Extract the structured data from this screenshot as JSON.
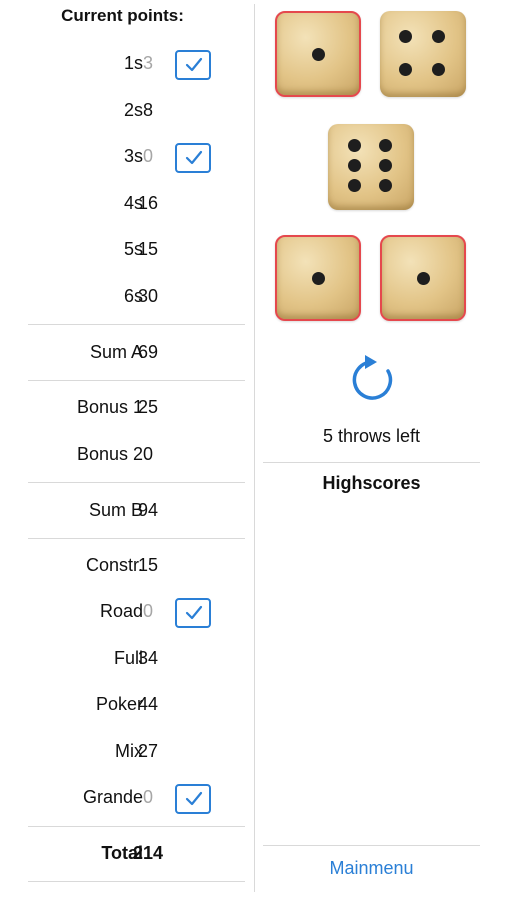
{
  "score": {
    "title": "Current points:",
    "upper": [
      {
        "label": "1s",
        "value": "3",
        "muted": true,
        "checked": true
      },
      {
        "label": "2s",
        "value": "8",
        "muted": false,
        "checked": false
      },
      {
        "label": "3s",
        "value": "0",
        "muted": true,
        "checked": true
      },
      {
        "label": "4s",
        "value": "16",
        "muted": false,
        "checked": false
      },
      {
        "label": "5s",
        "value": "15",
        "muted": false,
        "checked": false
      },
      {
        "label": "6s",
        "value": "30",
        "muted": false,
        "checked": false
      }
    ],
    "sum_a": {
      "label": "Sum A",
      "value": "69"
    },
    "bonus1": {
      "label": "Bonus 1",
      "value": "25"
    },
    "bonus2": {
      "label": "Bonus 2",
      "value": "0"
    },
    "sum_b": {
      "label": "Sum B",
      "value": "94"
    },
    "lower": [
      {
        "label": "Constr.",
        "value": "15",
        "muted": false,
        "checked": false
      },
      {
        "label": "Road",
        "value": "0",
        "muted": true,
        "checked": true
      },
      {
        "label": "Full",
        "value": "34",
        "muted": false,
        "checked": false
      },
      {
        "label": "Poker",
        "value": "44",
        "muted": false,
        "checked": false
      },
      {
        "label": "Mix",
        "value": "27",
        "muted": false,
        "checked": false
      },
      {
        "label": "Grande",
        "value": "0",
        "muted": true,
        "checked": true
      }
    ],
    "total": {
      "label": "Total",
      "value": "214"
    }
  },
  "dice": [
    {
      "face": 1,
      "held": true
    },
    {
      "face": 4,
      "held": false
    },
    {
      "face": 6,
      "held": false
    },
    {
      "face": 1,
      "held": true
    },
    {
      "face": 1,
      "held": true
    }
  ],
  "throws_left": "5 throws left",
  "highscores_title": "Highscores",
  "mainmenu_label": "Mainmenu",
  "colors": {
    "accent": "#2a7fd6",
    "held_border": "#e5484d"
  },
  "icons": {
    "reroll": "refresh-icon",
    "check": "checkmark-icon"
  }
}
